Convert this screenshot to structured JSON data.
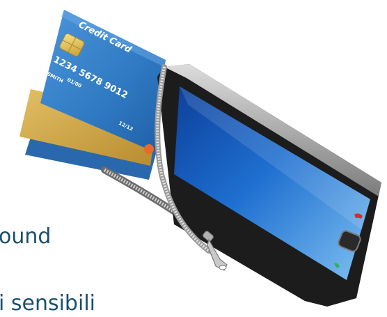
{
  "slide": {
    "line1": "ound",
    "line2": "i sensibili"
  },
  "card": {
    "title": "Credit Card",
    "number": "1234 5678 9012",
    "name": "J. SMITH",
    "valid_from": "01/00",
    "expiry": "12/12"
  },
  "colors": {
    "text": "#1b4f6e",
    "card_blue": "#2f79c2",
    "card_gold": "#c9a24a",
    "screen_blue": "#1e6fd0",
    "phone_body": "#1c1c1c",
    "zipper": "#b9b9b9"
  },
  "icons": [
    "chip-icon",
    "zipper-pull-icon",
    "end-call-icon",
    "call-icon",
    "home-button-icon"
  ]
}
